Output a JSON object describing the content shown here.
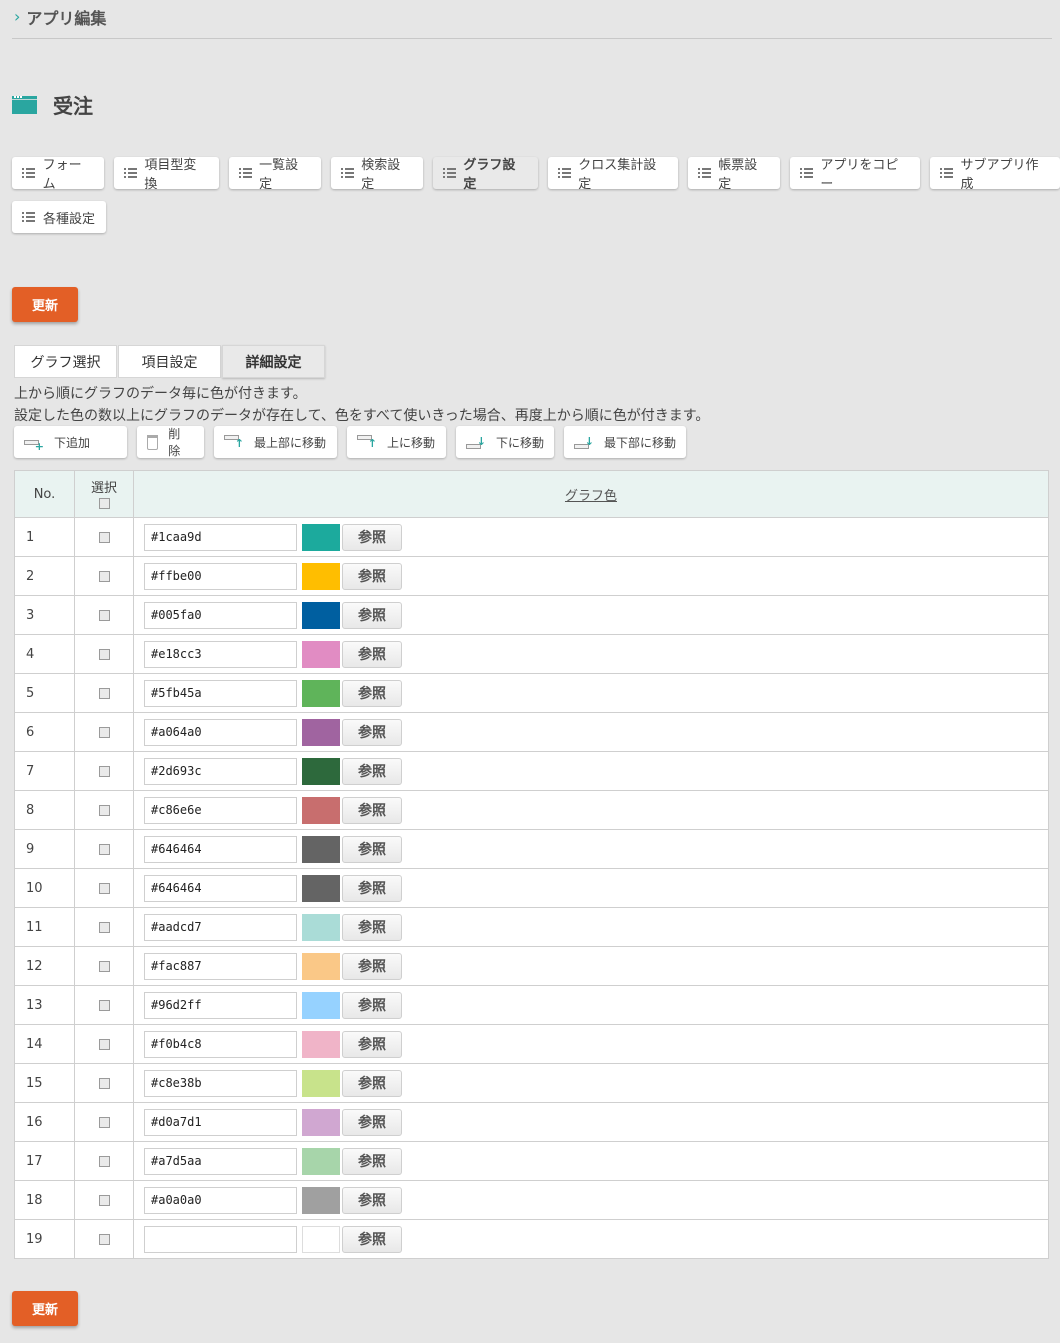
{
  "breadcrumb": {
    "label": "アプリ編集"
  },
  "app": {
    "title": "受注"
  },
  "nav": {
    "row1": [
      {
        "label": "フォーム",
        "active": false
      },
      {
        "label": "項目型変換",
        "active": false
      },
      {
        "label": "一覧設定",
        "active": false
      },
      {
        "label": "検索設定",
        "active": false
      },
      {
        "label": "グラフ設定",
        "active": true
      },
      {
        "label": "クロス集計設定",
        "active": false
      },
      {
        "label": "帳票設定",
        "active": false
      },
      {
        "label": "アプリをコピー",
        "active": false
      },
      {
        "label": "サブアプリ作成",
        "active": false
      }
    ],
    "row2": [
      {
        "label": "各種設定",
        "active": false
      }
    ]
  },
  "update_button": {
    "label": "更新"
  },
  "tabs": [
    {
      "label": "グラフ選択",
      "active": false
    },
    {
      "label": "項目設定",
      "active": false
    },
    {
      "label": "詳細設定",
      "active": true
    }
  ],
  "description": {
    "line1": "上から順にグラフのデータ毎に色が付きます。",
    "line2": "設定した色の数以上にグラフのデータが存在して、色をすべて使いきった場合、再度上から順に色が付きます。"
  },
  "toolbar": {
    "add_below": "下追加",
    "delete": "削 除",
    "move_top": "最上部に移動",
    "move_up": "上に移動",
    "move_down": "下に移動",
    "move_bottom": "最下部に移動"
  },
  "table": {
    "headers": {
      "no": "No.",
      "select": "選択",
      "color": "グラフ色"
    },
    "ref_label": "参照",
    "rows": [
      {
        "no": "1",
        "hex": "#1caa9d"
      },
      {
        "no": "2",
        "hex": "#ffbe00"
      },
      {
        "no": "3",
        "hex": "#005fa0"
      },
      {
        "no": "4",
        "hex": "#e18cc3"
      },
      {
        "no": "5",
        "hex": "#5fb45a"
      },
      {
        "no": "6",
        "hex": "#a064a0"
      },
      {
        "no": "7",
        "hex": "#2d693c"
      },
      {
        "no": "8",
        "hex": "#c86e6e"
      },
      {
        "no": "9",
        "hex": "#646464"
      },
      {
        "no": "10",
        "hex": "#646464"
      },
      {
        "no": "11",
        "hex": "#aadcd7"
      },
      {
        "no": "12",
        "hex": "#fac887"
      },
      {
        "no": "13",
        "hex": "#96d2ff"
      },
      {
        "no": "14",
        "hex": "#f0b4c8"
      },
      {
        "no": "15",
        "hex": "#c8e38b"
      },
      {
        "no": "16",
        "hex": "#d0a7d1"
      },
      {
        "no": "17",
        "hex": "#a7d5aa"
      },
      {
        "no": "18",
        "hex": "#a0a0a0"
      },
      {
        "no": "19",
        "hex": ""
      }
    ]
  }
}
